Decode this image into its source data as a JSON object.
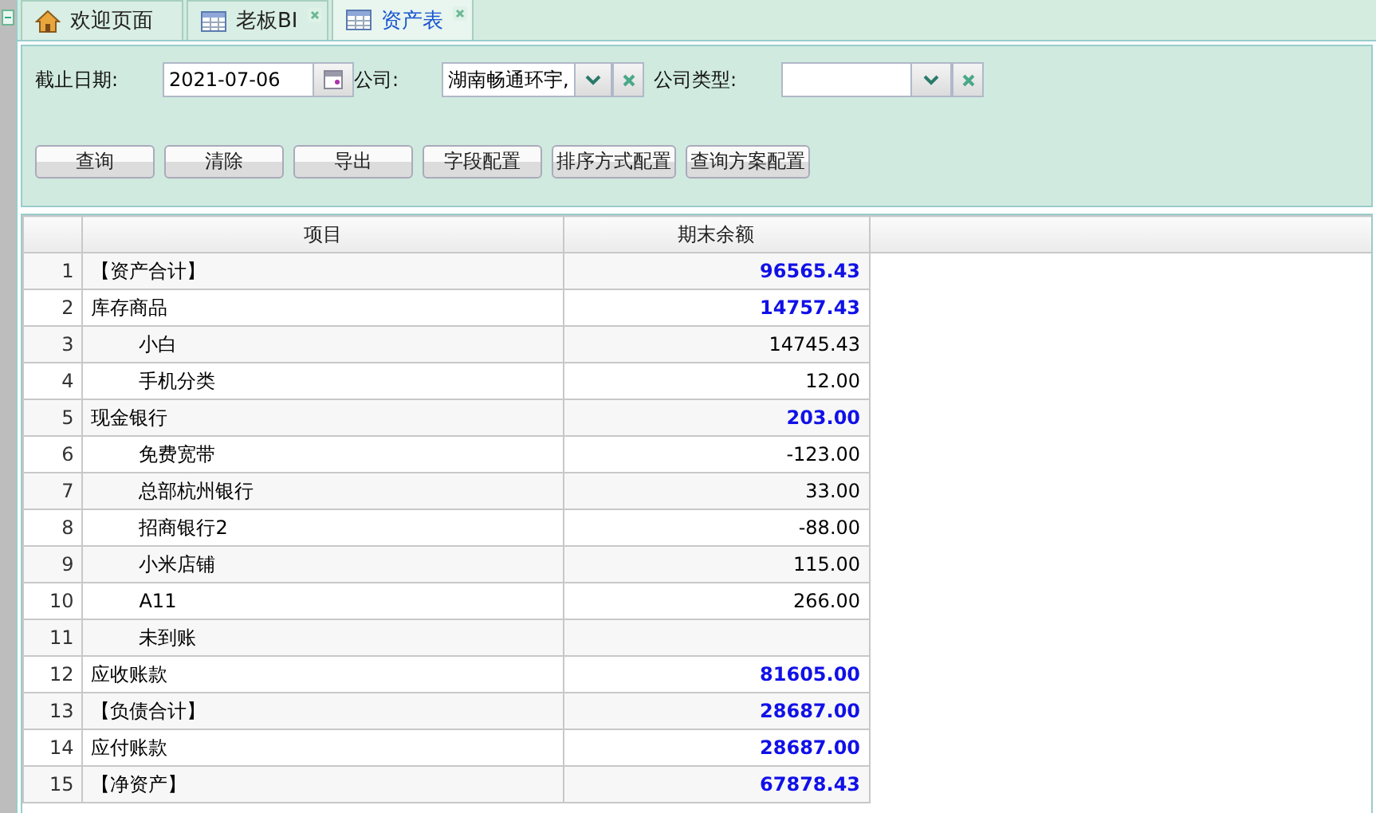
{
  "tabs": [
    {
      "label": "欢迎页面",
      "kind": "home",
      "closable": false,
      "selected": false
    },
    {
      "label": "老板BI",
      "kind": "table",
      "closable": true,
      "selected": false
    },
    {
      "label": "资产表",
      "kind": "table",
      "closable": true,
      "selected": true
    }
  ],
  "filters": [
    {
      "kind": "date",
      "label": "截止日期:",
      "value": "2021-07-06"
    },
    {
      "kind": "combo",
      "label": "公司:",
      "value": "湖南畅通环宇,"
    },
    {
      "kind": "combo",
      "label": "公司类型:"
    }
  ],
  "buttons": [
    "查询",
    "清除",
    "导出",
    "字段配置",
    "排序方式配置",
    "查询方案配置"
  ],
  "table": {
    "columns": [
      "项目",
      "期末余额"
    ],
    "rows": [
      {
        "no": "1",
        "item": "【资产合计】",
        "value": "96565.43",
        "bold": true
      },
      {
        "no": "2",
        "item": "库存商品",
        "value": "14757.43",
        "bold": true,
        "children": [
          {
            "no": "3",
            "item": "小白",
            "value": "14745.43",
            "bold": false
          },
          {
            "no": "4",
            "item": "手机分类",
            "value": "12.00",
            "bold": false
          }
        ]
      },
      {
        "no": "5",
        "item": "现金银行",
        "value": "203.00",
        "bold": true,
        "children": [
          {
            "no": "6",
            "item": "免费宽带",
            "value": "-123.00",
            "bold": false
          },
          {
            "no": "7",
            "item": "总部杭州银行",
            "value": "33.00",
            "bold": false
          },
          {
            "no": "8",
            "item": "招商银行2",
            "value": "-88.00",
            "bold": false
          },
          {
            "no": "9",
            "item": "小米店铺",
            "value": "115.00",
            "bold": false
          },
          {
            "no": "10",
            "item": "A11",
            "value": "266.00",
            "bold": false
          },
          {
            "no": "11",
            "item": "未到账"
          }
        ]
      },
      {
        "no": "12",
        "item": "应收账款",
        "value": "81605.00",
        "bold": true
      },
      {
        "no": "13",
        "item": "【负债合计】",
        "value": "28687.00",
        "bold": true
      },
      {
        "no": "14",
        "item": "应付账款",
        "value": "28687.00",
        "bold": true
      },
      {
        "no": "15",
        "item": "【净资产】",
        "value": "67878.43",
        "bold": true
      }
    ]
  }
}
